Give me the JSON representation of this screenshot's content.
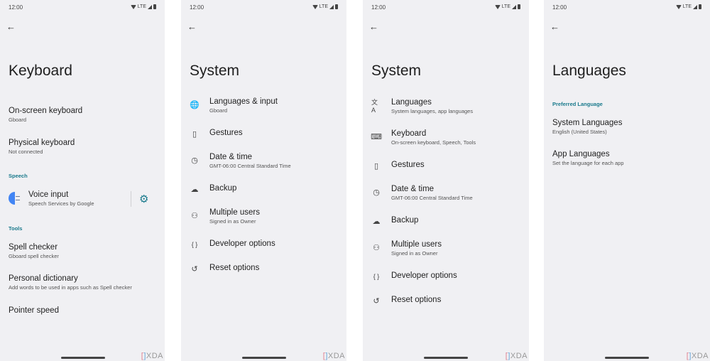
{
  "status_bar": {
    "time": "12:00",
    "network": "LTE",
    "icons": [
      "wifi-icon",
      "signal-icon",
      "battery-icon"
    ]
  },
  "watermark": {
    "bracket_left": "[",
    "bracket_right": "]",
    "brand": "XDA"
  },
  "colors": {
    "accent": "#1a7a8c",
    "background": "#f0f0f3",
    "voice_blue": "#4285f4"
  },
  "panels": [
    {
      "title": "Keyboard",
      "items": [
        {
          "title": "On-screen keyboard",
          "subtitle": "Gboard"
        },
        {
          "title": "Physical keyboard",
          "subtitle": "Not connected"
        }
      ],
      "sections": [
        {
          "label": "Speech",
          "items": [
            {
              "title": "Voice input",
              "subtitle": "Speech Services by Google",
              "icon": "voice-input-icon",
              "action_icon": "gear-icon"
            }
          ]
        },
        {
          "label": "Tools",
          "items": [
            {
              "title": "Spell checker",
              "subtitle": "Gboard spell checker"
            },
            {
              "title": "Personal dictionary",
              "subtitle": "Add words to be used in apps such as Spell checker"
            },
            {
              "title": "Pointer speed",
              "subtitle": ""
            }
          ]
        }
      ]
    },
    {
      "title": "System",
      "items": [
        {
          "title": "Languages & input",
          "subtitle": "Gboard",
          "icon": "globe-icon",
          "glyph": "🌐"
        },
        {
          "title": "Gestures",
          "subtitle": "",
          "icon": "gestures-icon",
          "glyph": "▯"
        },
        {
          "title": "Date & time",
          "subtitle": "GMT-06:00 Central Standard Time",
          "icon": "clock-icon",
          "glyph": "◷"
        },
        {
          "title": "Backup",
          "subtitle": "",
          "icon": "cloud-upload-icon",
          "glyph": "☁"
        },
        {
          "title": "Multiple users",
          "subtitle": "Signed in as Owner",
          "icon": "person-icon",
          "glyph": "⚇"
        },
        {
          "title": "Developer options",
          "subtitle": "",
          "icon": "braces-icon",
          "glyph": "{ }"
        },
        {
          "title": "Reset options",
          "subtitle": "",
          "icon": "history-icon",
          "glyph": "↺"
        }
      ]
    },
    {
      "title": "System",
      "items": [
        {
          "title": "Languages",
          "subtitle": "System languages, app languages",
          "icon": "translate-icon",
          "glyph": "文A"
        },
        {
          "title": "Keyboard",
          "subtitle": "On-screen keyboard, Speech, Tools",
          "icon": "keyboard-icon",
          "glyph": "⌨"
        },
        {
          "title": "Gestures",
          "subtitle": "",
          "icon": "gestures-icon",
          "glyph": "▯"
        },
        {
          "title": "Date & time",
          "subtitle": "GMT-06:00 Central Standard Time",
          "icon": "clock-icon",
          "glyph": "◷"
        },
        {
          "title": "Backup",
          "subtitle": "",
          "icon": "cloud-upload-icon",
          "glyph": "☁"
        },
        {
          "title": "Multiple users",
          "subtitle": "Signed in as Owner",
          "icon": "person-icon",
          "glyph": "⚇"
        },
        {
          "title": "Developer options",
          "subtitle": "",
          "icon": "braces-icon",
          "glyph": "{ }"
        },
        {
          "title": "Reset options",
          "subtitle": "",
          "icon": "history-icon",
          "glyph": "↺"
        }
      ]
    },
    {
      "title": "Languages",
      "section_label": "Preferred Language",
      "items": [
        {
          "title": "System Languages",
          "subtitle": "English (United States)"
        },
        {
          "title": "App Languages",
          "subtitle": "Set the language for each app"
        }
      ]
    }
  ]
}
